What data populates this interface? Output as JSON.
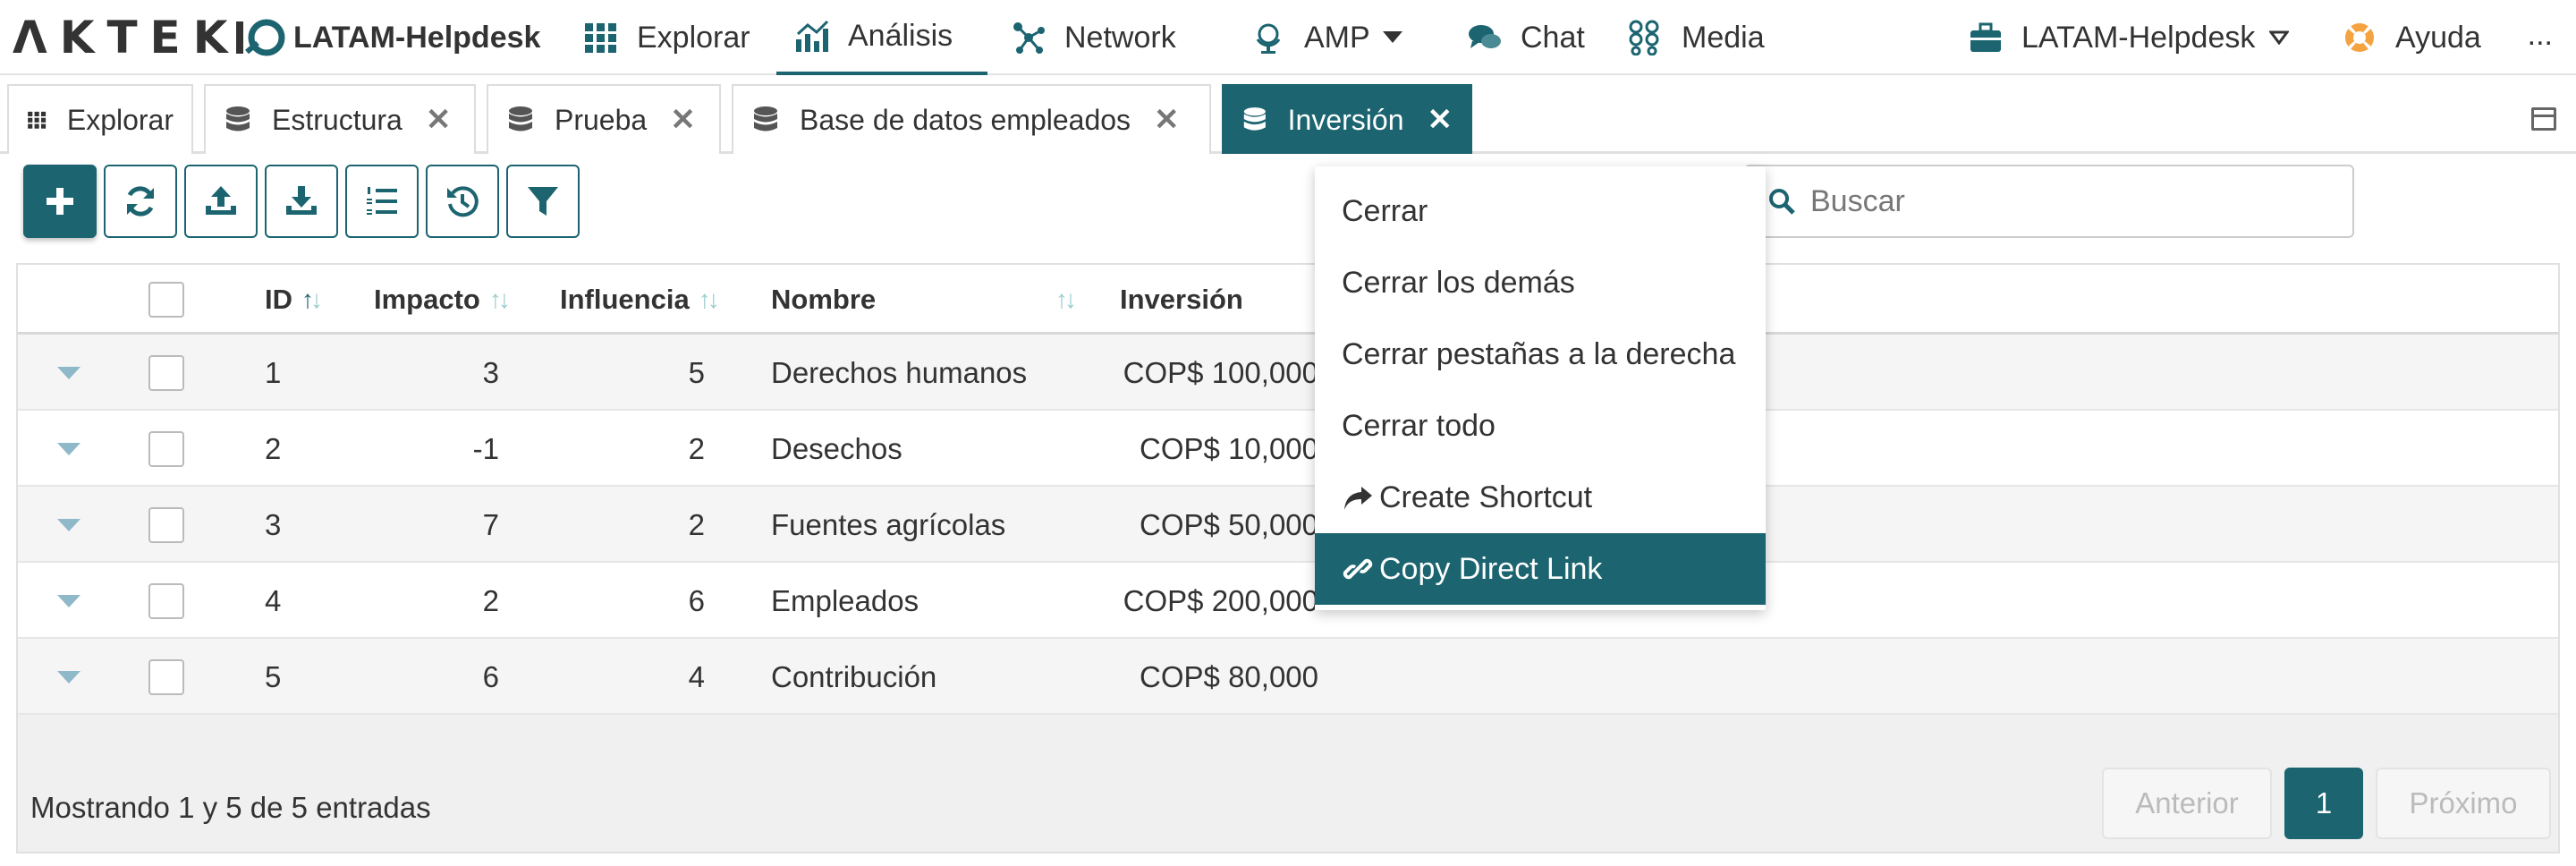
{
  "topnav": {
    "logo_text": "ΛKTEK",
    "brand": "LATAM-Helpdesk",
    "items": [
      {
        "label": "Explorar",
        "icon": "grid-icon"
      },
      {
        "label": "Análisis",
        "icon": "bar-chart-icon"
      },
      {
        "label": "Network",
        "icon": "network-icon"
      },
      {
        "label": "AMP",
        "icon": "globe-icon"
      },
      {
        "label": "Chat",
        "icon": "chat-icon"
      },
      {
        "label": "Media",
        "icon": "media-icon"
      }
    ],
    "workspace": "LATAM-Helpdesk",
    "help": "Ayuda",
    "more": "..."
  },
  "tabs": [
    {
      "label": "Explorar",
      "icon": "grid-icon",
      "closable": false
    },
    {
      "label": "Estructura",
      "icon": "database-icon",
      "closable": true
    },
    {
      "label": "Prueba",
      "icon": "database-icon",
      "closable": true
    },
    {
      "label": "Base de datos empleados",
      "icon": "database-icon",
      "closable": true
    },
    {
      "label": "Inversión",
      "icon": "database-icon",
      "closable": true,
      "active": true
    }
  ],
  "tab_close_glyph": "✕",
  "search": {
    "placeholder": "Buscar",
    "value": ""
  },
  "table": {
    "columns": [
      "ID",
      "Impacto",
      "Influencia",
      "Nombre",
      "Inversión"
    ],
    "sort_glyph_up": "↑",
    "sort_glyph_down": "↓",
    "rows": [
      {
        "id": "1",
        "impacto": "3",
        "influencia": "5",
        "nombre": "Derechos humanos",
        "inversion": "COP$ 100,000"
      },
      {
        "id": "2",
        "impacto": "-1",
        "influencia": "2",
        "nombre": "Desechos",
        "inversion": "COP$ 10,000"
      },
      {
        "id": "3",
        "impacto": "7",
        "influencia": "2",
        "nombre": "Fuentes agrícolas",
        "inversion": "COP$ 50,000"
      },
      {
        "id": "4",
        "impacto": "2",
        "influencia": "6",
        "nombre": "Empleados",
        "inversion": "COP$ 200,000"
      },
      {
        "id": "5",
        "impacto": "6",
        "influencia": "4",
        "nombre": "Contribución",
        "inversion": "COP$ 80,000"
      }
    ]
  },
  "pagination": {
    "info": "Mostrando 1 y 5 de 5 entradas",
    "prev": "Anterior",
    "current": "1",
    "next": "Próximo"
  },
  "context_menu": {
    "items": [
      {
        "label": "Cerrar"
      },
      {
        "label": "Cerrar los demás"
      },
      {
        "label": "Cerrar pestañas a la derecha"
      },
      {
        "label": "Cerrar todo"
      },
      {
        "label": "Create Shortcut",
        "icon": "share-arrow-icon"
      },
      {
        "label": "Copy Direct Link",
        "icon": "link-icon",
        "highlighted": true
      }
    ]
  },
  "colors": {
    "accent": "#1b6470",
    "text": "#333333",
    "border": "#dddddd"
  }
}
